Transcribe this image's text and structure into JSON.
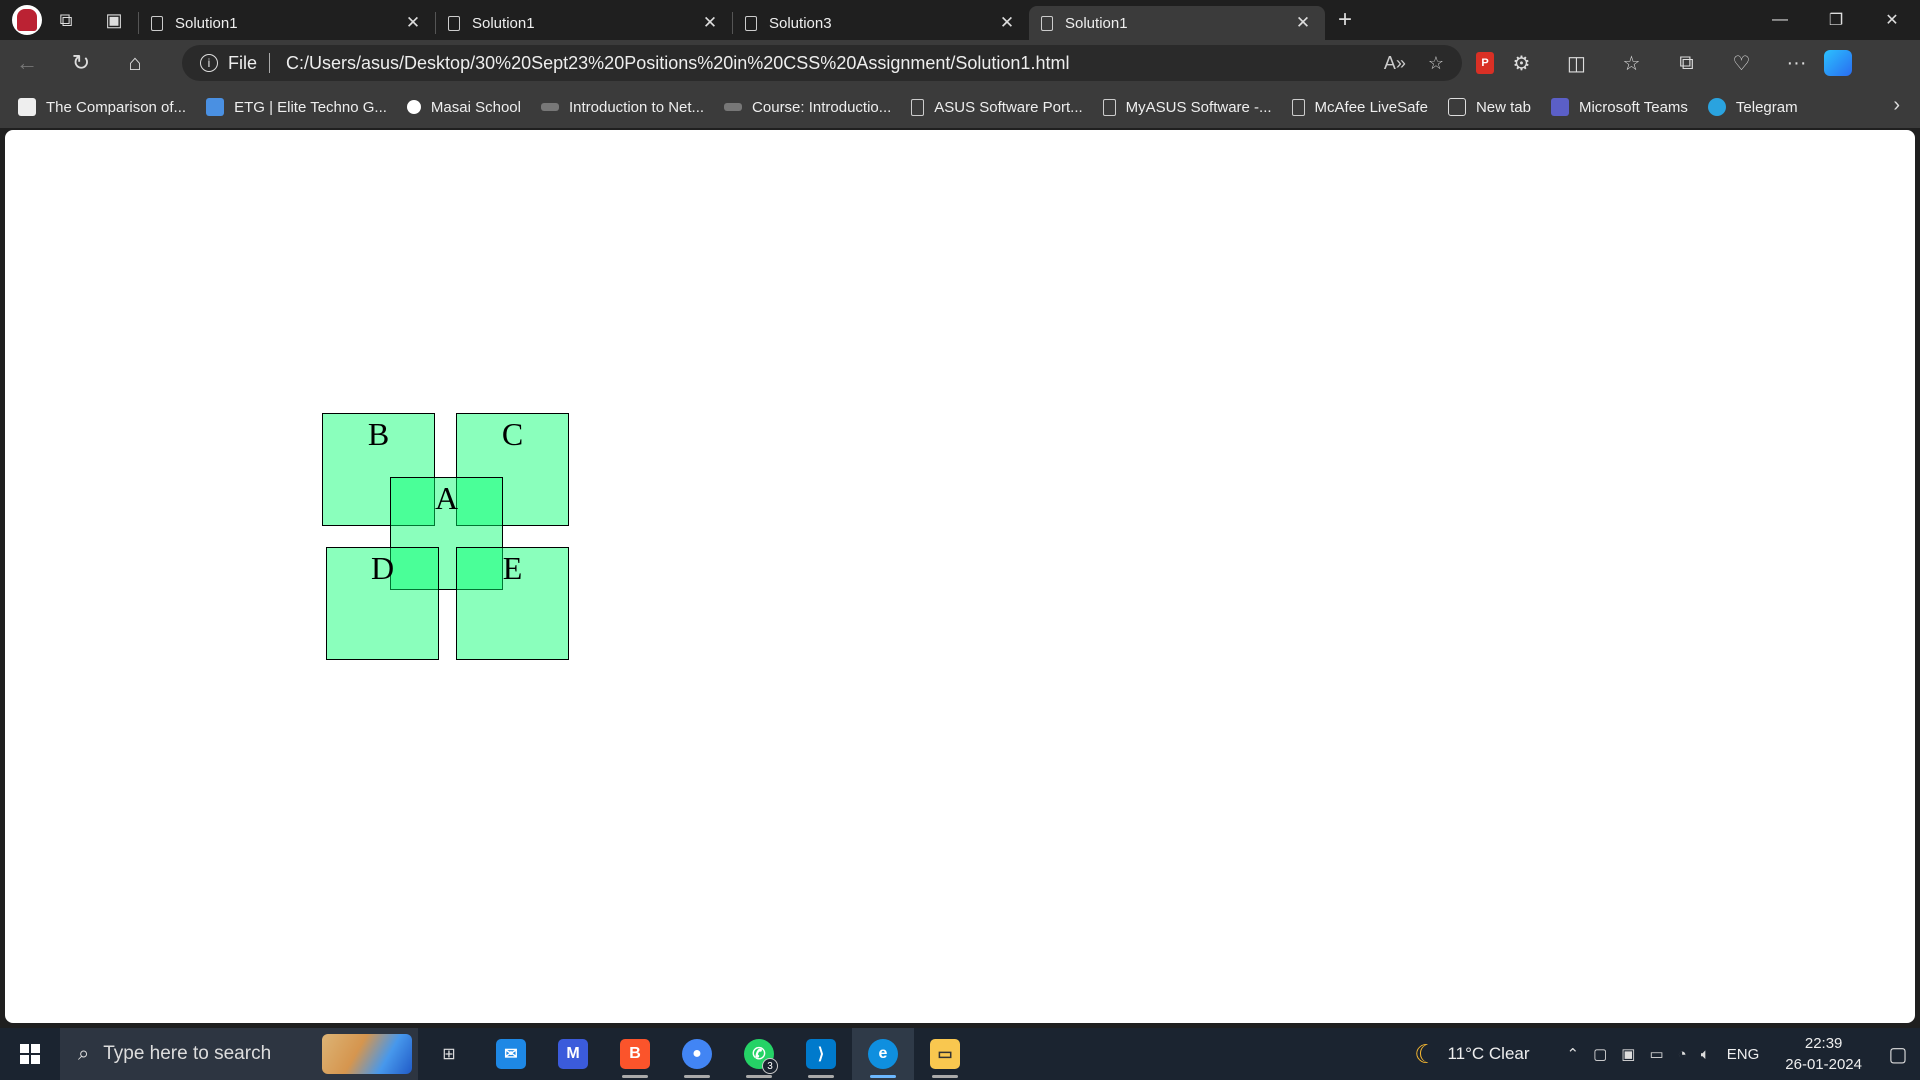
{
  "browser": {
    "tabs": [
      {
        "title": "Solution1",
        "active": false
      },
      {
        "title": "Solution1",
        "active": false
      },
      {
        "title": "Solution3",
        "active": false
      },
      {
        "title": "Solution1",
        "active": true
      }
    ],
    "new_tab_icon": "plus-icon",
    "address": {
      "scheme_label": "File",
      "url": "C:/Users/asus/Desktop/30%20Sept23%20Positions%20in%20CSS%20Assignment/Solution1.html"
    },
    "bookmarks": [
      {
        "label": "The Comparison of...",
        "icon": "dcb-icon",
        "color": "#ffffff"
      },
      {
        "label": "ETG | Elite Techno G...",
        "icon": "etg-icon",
        "color": "#4a90e2"
      },
      {
        "label": "Masai School",
        "icon": "masai-icon",
        "color": "#ffffff"
      },
      {
        "label": "Introduction to Net...",
        "icon": "course-icon",
        "color": "#777777"
      },
      {
        "label": "Course: Introductio...",
        "icon": "course-icon",
        "color": "#777777"
      },
      {
        "label": "ASUS Software Port...",
        "icon": "page-icon",
        "color": ""
      },
      {
        "label": "MyASUS Software -...",
        "icon": "page-icon",
        "color": ""
      },
      {
        "label": "McAfee LiveSafe",
        "icon": "page-icon",
        "color": ""
      },
      {
        "label": "New tab",
        "icon": "newtab-icon",
        "color": "#dddddd"
      },
      {
        "label": "Microsoft Teams",
        "icon": "teams-icon",
        "color": "#5b5fc7"
      },
      {
        "label": "Telegram",
        "icon": "telegram-icon",
        "color": "#2aa3df"
      }
    ]
  },
  "page": {
    "boxes": [
      {
        "label": "B"
      },
      {
        "label": "C"
      },
      {
        "label": "A"
      },
      {
        "label": "D"
      },
      {
        "label": "E"
      }
    ],
    "box_color": "rgba(0,255,110,0.46)"
  },
  "taskbar": {
    "search_placeholder": "Type here to search",
    "apps": [
      {
        "name": "task-view",
        "icon": "task-view-icon"
      },
      {
        "name": "mail",
        "icon": "mail-icon",
        "color": "#1e88e5"
      },
      {
        "name": "app-m",
        "icon": "m-app-icon",
        "color": "#3b5bdb"
      },
      {
        "name": "brave",
        "icon": "brave-icon",
        "color": "#fb542b"
      },
      {
        "name": "chrome",
        "icon": "chrome-icon",
        "color": "#4285f4"
      },
      {
        "name": "whatsapp",
        "icon": "whatsapp-icon",
        "color": "#25d366",
        "badge": "3"
      },
      {
        "name": "vscode",
        "icon": "vscode-icon",
        "color": "#007acc"
      },
      {
        "name": "edge",
        "icon": "edge-icon",
        "color": "#0f8fdf"
      },
      {
        "name": "explorer",
        "icon": "folder-icon",
        "color": "#f9c74f"
      }
    ],
    "weather": {
      "temp": "11°C",
      "condition": "Clear"
    },
    "language": "ENG",
    "time": "22:39",
    "date": "26-01-2024"
  }
}
